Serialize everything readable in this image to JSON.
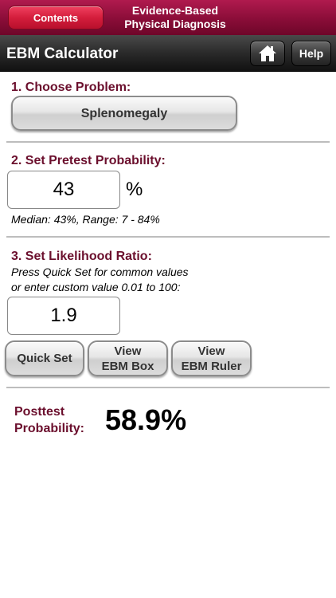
{
  "header": {
    "contents_label": "Contents",
    "title_line1": "Evidence-Based",
    "title_line2": "Physical Diagnosis"
  },
  "navbar": {
    "title": "EBM Calculator",
    "help_label": "Help"
  },
  "step1": {
    "label": "1. Choose Problem:",
    "problem": "Splenomegaly"
  },
  "step2": {
    "label": "2. Set Pretest Probability:",
    "value": "43",
    "unit": "%",
    "note": "Median: 43%, Range: 7 - 84%"
  },
  "step3": {
    "label": "3. Set Likelihood Ratio:",
    "instruction_line1": "Press Quick Set for common values",
    "instruction_line2": "or enter custom value 0.01 to 100:",
    "value": "1.9",
    "quick_set_label": "Quick Set",
    "view_box_line1": "View",
    "view_box_line2": "EBM Box",
    "view_ruler_line1": "View",
    "view_ruler_line2": "EBM Ruler"
  },
  "result": {
    "label_line1": "Posttest",
    "label_line2": "Probability:",
    "value": "58.9%"
  },
  "colors": {
    "header_red": "#8a0d38",
    "label_maroon": "#6b0f2d"
  }
}
